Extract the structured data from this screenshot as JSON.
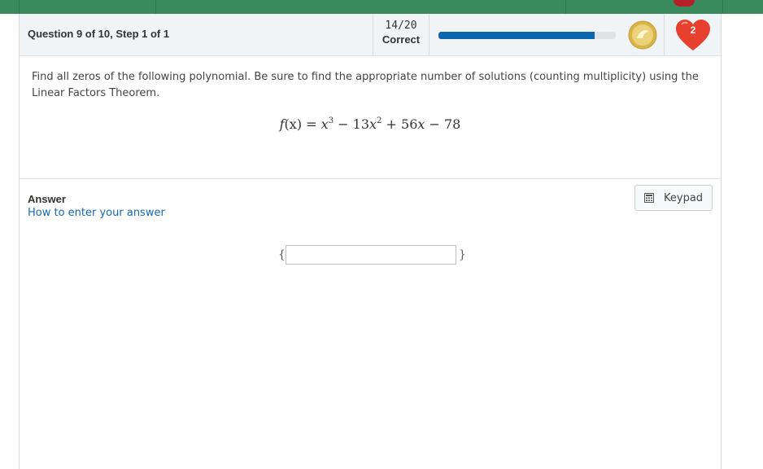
{
  "header": {
    "question_title": "Question 9 of 10, Step 1 of 1",
    "score_fraction": "14/20",
    "score_label": "Correct",
    "progress_fraction": 0.88,
    "hearts_count": "2"
  },
  "question": {
    "prompt": "Find all zeros of the following polynomial. Be sure to find the appropriate number of solutions (counting multiplicity) using the Linear Factors Theorem.",
    "equation": {
      "lhs_func": "f",
      "lhs_var": "(x)",
      "equals": "=",
      "t1_var": "x",
      "t1_exp": "3",
      "op1": "−",
      "t2_coef": "13",
      "t2_var": "x",
      "t2_exp": "2",
      "op2": "+",
      "t3_coef": "56",
      "t3_var": "x",
      "op3": "−",
      "t4": "78"
    }
  },
  "answer": {
    "title": "Answer",
    "how_to_link": "How to enter your answer",
    "keypad_label": "Keypad",
    "open_brace": "{",
    "close_brace": "}",
    "input_value": ""
  },
  "colors": {
    "topbar": "#3b8a5e",
    "progress_fill": "#0d65ad",
    "link": "#1168b5",
    "heart": "#e8402f",
    "coin": "#e3c25a"
  },
  "icons": {
    "coin": "gold-coin-icon",
    "heart": "heart-icon",
    "keypad": "calculator-icon"
  }
}
